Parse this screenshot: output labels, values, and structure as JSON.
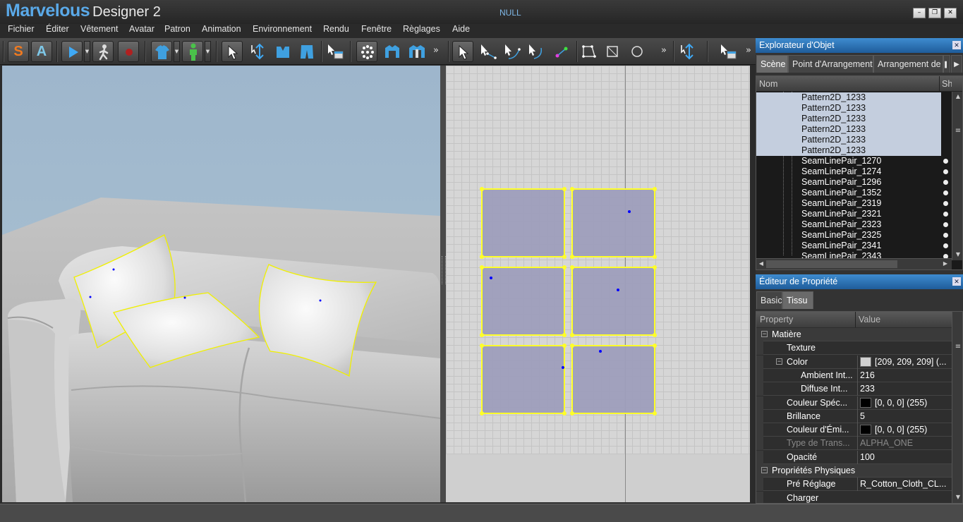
{
  "app": {
    "name_part1": "Marvelous",
    "name_part2": "Designer 2",
    "document_title": "NULL"
  },
  "window_controls": {
    "minimize": "–",
    "restore": "❐",
    "close": "✕"
  },
  "menu": [
    "Fichier",
    "Éditer",
    "Vêtement",
    "Avatar",
    "Patron",
    "Animation",
    "Environnement",
    "Rendu",
    "Fenêtre",
    "Règlages",
    "Aide"
  ],
  "toolbar3d": {
    "mode_s": "S",
    "mode_a": "A",
    "more": "»"
  },
  "toolbar2d": {
    "more": "»"
  },
  "object_explorer": {
    "title": "Explorateur d'Objet",
    "close": "✕",
    "tabs": [
      "Scène",
      "Point d'Arrangement",
      "Arrangement de"
    ],
    "tab_more": "▶",
    "columns": [
      "Nom",
      "Sh"
    ],
    "rows": [
      {
        "label": "Pattern2D_1233",
        "selected": true,
        "dot": false
      },
      {
        "label": "Pattern2D_1233",
        "selected": true,
        "dot": false
      },
      {
        "label": "Pattern2D_1233",
        "selected": true,
        "dot": false
      },
      {
        "label": "Pattern2D_1233",
        "selected": true,
        "dot": false
      },
      {
        "label": "Pattern2D_1233",
        "selected": true,
        "dot": false
      },
      {
        "label": "Pattern2D_1233",
        "selected": true,
        "dot": false
      },
      {
        "label": "SeamLinePair_1270",
        "selected": false,
        "dot": true
      },
      {
        "label": "SeamLinePair_1274",
        "selected": false,
        "dot": true
      },
      {
        "label": "SeamLinePair_1296",
        "selected": false,
        "dot": true
      },
      {
        "label": "SeamLinePair_1352",
        "selected": false,
        "dot": true
      },
      {
        "label": "SeamLinePair_2319",
        "selected": false,
        "dot": true
      },
      {
        "label": "SeamLinePair_2321",
        "selected": false,
        "dot": true
      },
      {
        "label": "SeamLinePair_2323",
        "selected": false,
        "dot": true
      },
      {
        "label": "SeamLinePair_2325",
        "selected": false,
        "dot": true
      },
      {
        "label": "SeamLinePair_2341",
        "selected": false,
        "dot": true
      },
      {
        "label": "SeamLinePair_2343",
        "selected": false,
        "dot": true
      }
    ]
  },
  "property_editor": {
    "title": "Éditeur de Propriété",
    "close": "✕",
    "tabs": [
      "Basic",
      "Tissu"
    ],
    "columns": [
      "Property",
      "Value"
    ],
    "rows": [
      {
        "name": "Matière",
        "value": "",
        "level": 0,
        "section": true,
        "expander": "−"
      },
      {
        "name": "Texture",
        "value": "",
        "level": 2
      },
      {
        "name": "Color",
        "value": "[209, 209, 209] (...",
        "level": 2,
        "swatch": "#d1d1d1",
        "expander": "−"
      },
      {
        "name": "Ambient Int...",
        "value": "216",
        "level": 3
      },
      {
        "name": "Diffuse Int...",
        "value": "233",
        "level": 3
      },
      {
        "name": "Couleur Spéc...",
        "value": "[0, 0, 0] (255)",
        "level": 2,
        "swatch": "#000000"
      },
      {
        "name": "Brillance",
        "value": "5",
        "level": 2
      },
      {
        "name": "Couleur d'Émi...",
        "value": "[0, 0, 0] (255)",
        "level": 2,
        "swatch": "#000000"
      },
      {
        "name": "Type de Trans...",
        "value": "ALPHA_ONE",
        "level": 2,
        "disabled": true
      },
      {
        "name": "Opacité",
        "value": "100",
        "level": 2
      },
      {
        "name": "Propriétés Physiques",
        "value": "",
        "level": 0,
        "section": true,
        "expander": "−"
      },
      {
        "name": "Pré Réglage",
        "value": "R_Cotton_Cloth_CL...",
        "level": 2
      },
      {
        "name": "Charger",
        "value": "",
        "level": 2
      }
    ]
  },
  "status": {
    "text": ""
  },
  "colors": {
    "accent_blue": "#5aa9e8",
    "pattern_fill": "#9e9ebc",
    "pattern_outline": "#ffff28",
    "selection_row": "#c4cede",
    "pin": "#0000ff"
  }
}
